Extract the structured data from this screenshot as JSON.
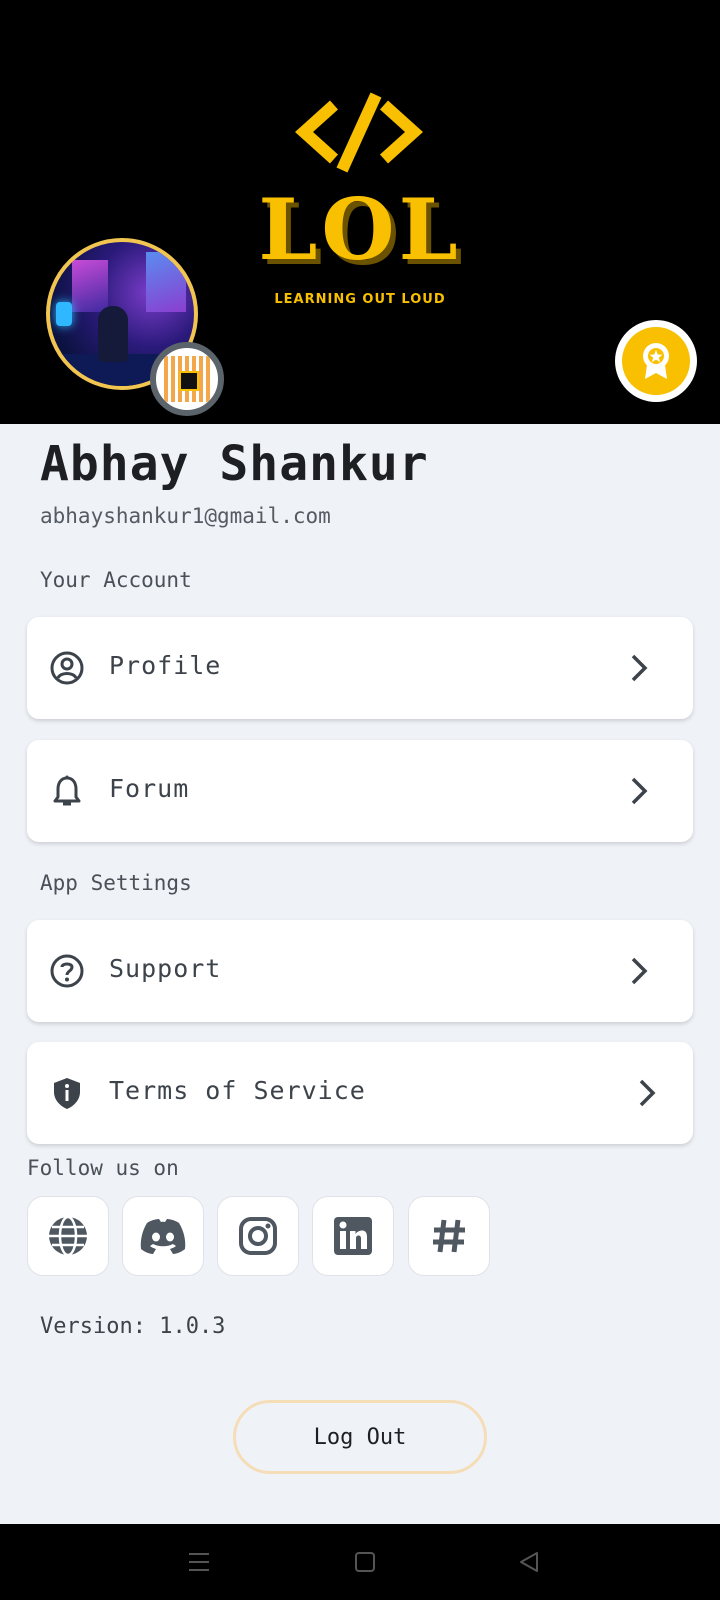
{
  "header": {
    "logo_text": "LOL",
    "logo_tagline": "LEARNING OUT LOUD",
    "logo_icon": "code-brackets-icon",
    "award_icon": "award-ribbon-icon",
    "brand_color": "#f8c000"
  },
  "user": {
    "name": "Abhay Shankur",
    "email": "abhayshankur1@gmail.com"
  },
  "sections": {
    "account_label": "Your Account",
    "settings_label": "App Settings",
    "follow_label": "Follow us on"
  },
  "menu": {
    "profile": {
      "label": "Profile",
      "icon": "user-circle-icon"
    },
    "forum": {
      "label": "Forum",
      "icon": "bell-icon"
    },
    "support": {
      "label": "Support",
      "icon": "question-circle-icon"
    },
    "terms": {
      "label": "Terms of Service",
      "icon": "shield-info-icon"
    }
  },
  "social": [
    {
      "icon": "globe-icon"
    },
    {
      "icon": "discord-icon"
    },
    {
      "icon": "instagram-icon"
    },
    {
      "icon": "linkedin-icon"
    },
    {
      "icon": "hashtag-icon"
    }
  ],
  "version_text": "Version: 1.0.3",
  "logout_label": "Log Out",
  "system_nav": [
    "menu-icon",
    "home-square-icon",
    "back-triangle-icon"
  ]
}
